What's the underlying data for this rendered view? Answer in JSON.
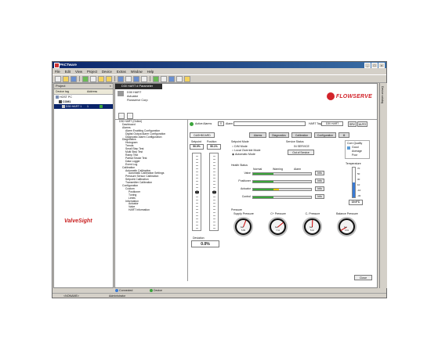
{
  "window": {
    "title": "PACTware"
  },
  "menu": [
    "File",
    "Edit",
    "View",
    "Project",
    "Device",
    "Extras",
    "Window",
    "Help"
  ],
  "project": {
    "header": "Project",
    "columns": {
      "tag": "Device tag",
      "address": "Address"
    },
    "rows": [
      "HOST PC",
      "COM1",
      "D30 HART 1"
    ],
    "selected_address": "1"
  },
  "document": {
    "tab": "D30 HART # Parameter",
    "device_lines": [
      "D30 HART",
      "Actuator",
      "Flowserve Corp"
    ],
    "brand_logo": "FLOWSERVE"
  },
  "tree": [
    "D30 HART (Online)",
    "Dashboard",
    "Alarms",
    "Alarm Enabling Configuration",
    "Digital Output Alarm Configuration",
    "Diagnostic Alarm Configuration",
    "Diagnostics",
    "Histogram",
    "Trends",
    "Small Step Test",
    "Multi Step Test",
    "Ramp Test",
    "Partial Stroke Test",
    "Data Logger",
    "Event Log",
    "Calibration",
    "Automatic Calibration",
    "Automatic Calibration Settings",
    "Pressure Sensor Calibration",
    "Setpoint Calibration",
    "Transmitter Calibration",
    "Configuration",
    "Custom",
    "Positioner",
    "Tuning",
    "Limits",
    "Information",
    "Actuator",
    "Valve",
    "HART Information"
  ],
  "status_row": {
    "active_alarms_label": "Active Alarms",
    "active_alarms_count": "0",
    "alarms_label": "Alarm",
    "hart_tag_label": "HART Tag",
    "hart_tag_value": "D30 HART",
    "mode_srv": "SRV",
    "mode_auto": "AUTO"
  },
  "tabs": [
    "DASHBOARD",
    "Alarms",
    "Diagnostics",
    "Calibration",
    "Configuration"
  ],
  "setpoint": {
    "label": "Setpoint",
    "value": "50.0%"
  },
  "position": {
    "label": "Position",
    "value": "50.1%"
  },
  "setpoint_mode": {
    "title": "Setpoint Mode",
    "options": [
      "D/M Mode",
      "Local Override Mode",
      "Automatic Mode"
    ],
    "selected": "Automatic Mode"
  },
  "service_status": {
    "title": "Service Status",
    "state": "IN SERVICE",
    "button": "Out of Service"
  },
  "com_quality": {
    "title": "Com Quality",
    "levels": [
      "Good",
      "Average",
      "Poor"
    ]
  },
  "temperature": {
    "title": "Temperature",
    "ticks": [
      "70",
      "50",
      "30",
      "10",
      "-10",
      "-30"
    ],
    "value": "19.9°C",
    "fraction": 0.5
  },
  "health_status": {
    "title": "Health Status",
    "columns": [
      "Normal",
      "Warning",
      "Alarm"
    ],
    "rows": [
      {
        "name": "Valve",
        "normal_fraction": 0.35,
        "warning_fraction": 0.0,
        "info": "Info"
      },
      {
        "name": "Positioner",
        "normal_fraction": 0.35,
        "warning_fraction": 0.0,
        "info": "Info"
      },
      {
        "name": "Actuator",
        "normal_fraction": 0.35,
        "warning_fraction": 0.1,
        "info": "Info"
      },
      {
        "name": "Control",
        "normal_fraction": 0.35,
        "warning_fraction": 0.0,
        "info": "Info"
      }
    ]
  },
  "deviation": {
    "label": "Deviation",
    "value": "0.0%"
  },
  "pressure": {
    "title": "Pressure",
    "gauges": [
      {
        "label": "Supply Pressure",
        "unit": "bar",
        "reading": "5.89"
      },
      {
        "label": "C+ Pressure",
        "unit": "bar",
        "reading": "7.11"
      },
      {
        "label": "C- Pressure",
        "unit": "bar",
        "reading": "5.10"
      },
      {
        "label": "Balance Pressure",
        "unit": "bar",
        "reading": "0.01"
      }
    ]
  },
  "footer": {
    "brand": "ValveSight",
    "close": "Close"
  },
  "statusbar": {
    "connected": "Connected",
    "device": "Device",
    "noname": "<NONAME>",
    "user": "Administrator"
  },
  "right_panel": "Device catalog"
}
